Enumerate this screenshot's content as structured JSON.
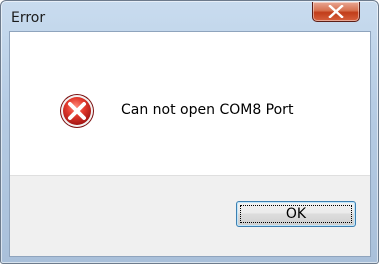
{
  "window": {
    "title": "Error",
    "close_icon": "close-icon"
  },
  "dialog": {
    "icon": "error-icon",
    "message": "Can not open COM8 Port",
    "ok_label": "OK"
  },
  "colors": {
    "close_button": "#c94a2b",
    "error_icon_red": "#d32121",
    "frame": "#b6cce4",
    "footer": "#f0f0f0"
  }
}
